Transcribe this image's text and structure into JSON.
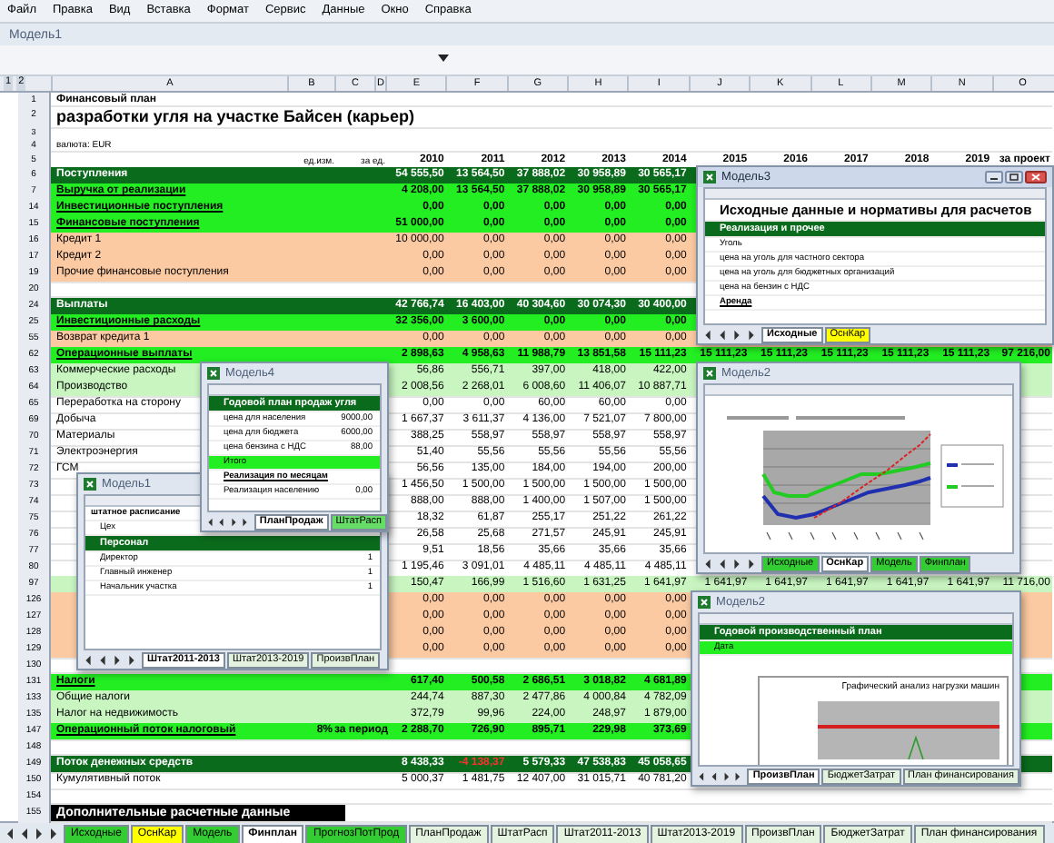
{
  "menu": [
    "Файл",
    "Правка",
    "Вид",
    "Вставка",
    "Формат",
    "Сервис",
    "Данные",
    "Окно",
    "Справка"
  ],
  "workbook_title": "Модель1",
  "outline_levels": [
    "1",
    "2"
  ],
  "columns": [
    "A",
    "B",
    "C",
    "D",
    "E",
    "F",
    "G",
    "H",
    "I",
    "J",
    "K",
    "L",
    "M",
    "N",
    "O"
  ],
  "header": {
    "row_numbers": [
      "1",
      "2",
      "3",
      "4",
      "5"
    ],
    "title": "Финансовый план",
    "subtitle": "разработки угля на участке Байсен (карьер)",
    "currency": "валюта: EUR",
    "unit": "ед.изм.",
    "per": "за ед.",
    "years": [
      "2010",
      "2011",
      "2012",
      "2013",
      "2014",
      "2015",
      "2016",
      "2017",
      "2018",
      "2019",
      "за проект"
    ]
  },
  "rows": [
    {
      "num": "6",
      "kind": "dark",
      "label": "Поступления",
      "values": [
        "54 555,50",
        "13 564,50",
        "37 888,02",
        "30 958,89",
        "30 565,17"
      ]
    },
    {
      "num": "7",
      "kind": "bright",
      "label": "Выручка от реализации",
      "values": [
        "4 208,00",
        "13 564,50",
        "37 888,02",
        "30 958,89",
        "30 565,17"
      ]
    },
    {
      "num": "14",
      "kind": "bright",
      "label": "Инвестиционные поступления",
      "values": [
        "0,00",
        "0,00",
        "0,00",
        "0,00",
        "0,00"
      ]
    },
    {
      "num": "15",
      "kind": "bright",
      "label": "Финансовые поступления",
      "values": [
        "51 000,00",
        "0,00",
        "0,00",
        "0,00",
        "0,00"
      ]
    },
    {
      "num": "16",
      "kind": "peach",
      "label": "Кредит 1",
      "values": [
        "10 000,00",
        "0,00",
        "0,00",
        "0,00",
        "0,00"
      ]
    },
    {
      "num": "17",
      "kind": "peach",
      "label": "Кредит 2",
      "values": [
        "0,00",
        "0,00",
        "0,00",
        "0,00",
        "0,00"
      ]
    },
    {
      "num": "19",
      "kind": "peach",
      "label": "Прочие финансовые поступления",
      "values": [
        "0,00",
        "0,00",
        "0,00",
        "0,00",
        "0,00"
      ]
    },
    {
      "num": "20",
      "kind": "blank"
    },
    {
      "num": "24",
      "kind": "dark",
      "label": "Выплаты",
      "values": [
        "42 766,74",
        "16 403,00",
        "40 304,60",
        "30 074,30",
        "30 400,00"
      ]
    },
    {
      "num": "25",
      "kind": "bright",
      "label": "Инвестиционные расходы",
      "values": [
        "32 356,00",
        "3 600,00",
        "0,00",
        "0,00",
        "0,00"
      ]
    },
    {
      "num": "55",
      "kind": "peach",
      "label": "Возврат кредита 1",
      "values": [
        "0,00",
        "0,00",
        "0,00",
        "0,00",
        "0,00"
      ]
    },
    {
      "num": "62",
      "kind": "bright",
      "label": "Операционные выплаты",
      "values": [
        "2 898,63",
        "4 958,63",
        "11 988,79",
        "13 851,58",
        "15 111,23",
        "15 111,23",
        "15 111,23",
        "15 111,23",
        "15 111,23",
        "15 111,23",
        "97 216,00"
      ]
    },
    {
      "num": "63",
      "kind": "light",
      "label": "Коммерческие расходы",
      "values": [
        "56,86",
        "556,71",
        "397,00",
        "418,00",
        "422,00"
      ]
    },
    {
      "num": "64",
      "kind": "light",
      "label": "Производство",
      "values": [
        "2 008,56",
        "2 268,01",
        "6 008,60",
        "11 406,07",
        "10 887,71"
      ]
    },
    {
      "num": "65",
      "kind": "plain",
      "label": "Переработка на сторону",
      "values": [
        "0,00",
        "0,00",
        "60,00",
        "60,00",
        "0,00"
      ]
    },
    {
      "num": "69",
      "kind": "plain",
      "label": "Добыча",
      "values": [
        "1 667,37",
        "3 611,37",
        "4 136,00",
        "7 521,07",
        "7 800,00"
      ]
    },
    {
      "num": "70",
      "kind": "plain",
      "label": "Материалы",
      "values": [
        "388,25",
        "558,97",
        "558,97",
        "558,97",
        "558,97"
      ]
    },
    {
      "num": "71",
      "kind": "plain",
      "label": "Электроэнергия",
      "values": [
        "51,40",
        "55,56",
        "55,56",
        "55,56",
        "55,56"
      ]
    },
    {
      "num": "72",
      "kind": "plain",
      "label": "ГСМ",
      "values": [
        "56,56",
        "135,00",
        "184,00",
        "194,00",
        "200,00"
      ]
    },
    {
      "num": "73",
      "kind": "plain",
      "values": [
        "1 456,50",
        "1 500,00",
        "1 500,00",
        "1 500,00",
        "1 500,00"
      ]
    },
    {
      "num": "74",
      "kind": "plain",
      "values": [
        "888,00",
        "888,00",
        "1 400,00",
        "1 507,00",
        "1 500,00"
      ]
    },
    {
      "num": "75",
      "kind": "plain",
      "values": [
        "18,32",
        "61,87",
        "255,17",
        "251,22",
        "261,22"
      ]
    },
    {
      "num": "76",
      "kind": "plain",
      "values": [
        "26,58",
        "25,68",
        "271,57",
        "245,91",
        "245,91"
      ]
    },
    {
      "num": "77",
      "kind": "plain",
      "values": [
        "9,51",
        "18,56",
        "35,66",
        "35,66",
        "35,66"
      ]
    },
    {
      "num": "80",
      "kind": "plain",
      "values": [
        "1 195,46",
        "3 091,01",
        "4 485,11",
        "4 485,11",
        "4 485,11"
      ]
    },
    {
      "num": "97",
      "kind": "light",
      "values": [
        "150,47",
        "166,99",
        "1 516,60",
        "1 631,25",
        "1 641,97",
        "1 641,97",
        "1 641,97",
        "1 641,97",
        "1 641,97",
        "1 641,97",
        "11 716,00"
      ]
    },
    {
      "num": "126",
      "kind": "peach",
      "values": [
        "0,00",
        "0,00",
        "0,00",
        "0,00",
        "0,00"
      ]
    },
    {
      "num": "127",
      "kind": "peach",
      "values": [
        "0,00",
        "0,00",
        "0,00",
        "0,00",
        "0,00"
      ]
    },
    {
      "num": "128",
      "kind": "peach",
      "values": [
        "0,00",
        "0,00",
        "0,00",
        "0,00",
        "0,00"
      ]
    },
    {
      "num": "129",
      "kind": "peach",
      "values": [
        "0,00",
        "0,00",
        "0,00",
        "0,00",
        "0,00"
      ]
    },
    {
      "num": "130",
      "kind": "plain"
    },
    {
      "num": "131",
      "kind": "bright",
      "label": "Налоги",
      "values": [
        "617,40",
        "500,58",
        "2 686,51",
        "3 018,82",
        "4 681,89"
      ]
    },
    {
      "num": "133",
      "kind": "light",
      "label": "Общие налоги",
      "values": [
        "244,74",
        "887,30",
        "2 477,86",
        "4 000,84",
        "4 782,09"
      ]
    },
    {
      "num": "135",
      "kind": "light",
      "label": "Налог на недвижимость",
      "values": [
        "372,79",
        "99,96",
        "224,00",
        "248,97",
        "1 879,00"
      ]
    },
    {
      "num": "147",
      "kind": "bright",
      "label": "Операционный поток налоговый",
      "b": "8%",
      "c": "за период",
      "values": [
        "2 288,70",
        "726,90",
        "895,71",
        "229,98",
        "373,69"
      ]
    },
    {
      "num": "148",
      "kind": "blank"
    },
    {
      "num": "149",
      "kind": "dark",
      "label": "Поток денежных средств",
      "values": [
        "8 438,33",
        {
          "text": "-4 138,37",
          "negative": true
        },
        "5 579,33",
        "47 538,83",
        "45 058,65"
      ]
    },
    {
      "num": "150",
      "kind": "plain",
      "label": "Кумулятивный поток",
      "values": [
        "5 000,37",
        "1 481,75",
        "12 407,00",
        "31 015,71",
        "40 781,20"
      ]
    },
    {
      "num": "154",
      "kind": "blank"
    },
    {
      "num": "155",
      "kind": "black",
      "label": "Дополнительные расчетные данные"
    }
  ],
  "windows": [
    {
      "kind": "staff",
      "title": "Модель1",
      "active": false,
      "rows": [
        {
          "kind": "subheading",
          "text": "штатное расписание"
        },
        {
          "kind": "plain",
          "text": "Цех"
        },
        {
          "kind": "band",
          "text": "Персонал"
        },
        {
          "kind": "plain",
          "text": "Директор",
          "value": "1"
        },
        {
          "kind": "plain",
          "text": "Главный инженер",
          "value": "1"
        },
        {
          "kind": "plain",
          "text": "Начальник участка",
          "value": "1"
        }
      ],
      "tabs": [
        {
          "label": "Штат2011-2013",
          "selected": true
        },
        {
          "label": "Штат2013-2019",
          "selected": false
        },
        {
          "label": "ПроизвПлан",
          "selected": false
        }
      ]
    },
    {
      "kind": "sales",
      "title": "Модель4",
      "active": false,
      "rows": [
        {
          "kind": "band",
          "text": "Годовой план продаж угля"
        },
        {
          "kind": "plain",
          "text": "цена для населения",
          "value": "9000,00"
        },
        {
          "kind": "plain",
          "text": "цена для бюджета",
          "value": "6000,00"
        },
        {
          "kind": "plain",
          "text": "цена бензина с НДС",
          "value": "88,00"
        },
        {
          "kind": "bright",
          "text": "Итого"
        },
        {
          "kind": "link",
          "text": "Реализация по месяцам"
        },
        {
          "kind": "plain",
          "text": "Реализация населению",
          "value": "0,00"
        }
      ],
      "tabs": [
        {
          "label": "ПланПродаж",
          "selected": true
        },
        {
          "label": "ШтатРасп",
          "selected": false,
          "color": "#66dd66"
        }
      ]
    },
    {
      "kind": "notes",
      "title": "Модель3",
      "active": true,
      "rows": [
        {
          "kind": "heading",
          "text": "Исходные данные и нормативы для расчетов"
        },
        {
          "kind": "band",
          "text": "Реализация и прочее"
        },
        {
          "kind": "plain",
          "text": "Уголь"
        },
        {
          "kind": "plain",
          "text": "цена на уголь для частного сектора"
        },
        {
          "kind": "plain",
          "text": "цена на уголь для бюджетных организаций"
        },
        {
          "kind": "plain",
          "text": "цена на бензин с НДС"
        },
        {
          "kind": "link",
          "text": "Аренда"
        }
      ],
      "tabs": [
        {
          "label": "Исходные",
          "selected": true
        },
        {
          "label": "ОснКар",
          "selected": false,
          "color": "#ffff00"
        }
      ]
    },
    {
      "kind": "chart",
      "title": "Модель2",
      "active": false,
      "tabs": [
        {
          "label": "Исходные",
          "selected": false,
          "color": "#33cc33"
        },
        {
          "label": "ОснКар",
          "selected": true
        },
        {
          "label": "Модель",
          "selected": false,
          "color": "#33cc33"
        },
        {
          "label": "Финплан",
          "selected": false,
          "color": "#33cc33"
        }
      ]
    },
    {
      "kind": "production",
      "title": "Модель2",
      "active": false,
      "chart_title": "Графический анализ нагрузки машин",
      "rows": [
        {
          "kind": "band",
          "text": "Годовой производственный план"
        },
        {
          "kind": "bright",
          "text": "Дата"
        }
      ],
      "tabs": [
        {
          "label": "ПроизвПлан",
          "selected": true
        },
        {
          "label": "БюджетЗатрат",
          "selected": false
        },
        {
          "label": "План финансирования",
          "selected": false
        }
      ]
    }
  ],
  "sheet_tabs": [
    {
      "label": "Исходные",
      "selected": false,
      "color": "#33cc33"
    },
    {
      "label": "ОснКар",
      "selected": false,
      "color": "#ffff00"
    },
    {
      "label": "Модель",
      "selected": false,
      "color": "#33cc33"
    },
    {
      "label": "Финплан",
      "selected": true
    },
    {
      "label": "ПрогнозПотПрод",
      "selected": false,
      "color": "#33cc33"
    },
    {
      "label": "ПланПродаж",
      "selected": false
    },
    {
      "label": "ШтатРасп",
      "selected": false
    },
    {
      "label": "Штат2011-2013",
      "selected": false
    },
    {
      "label": "Штат2013-2019",
      "selected": false
    },
    {
      "label": "ПроизвПлан",
      "selected": false
    },
    {
      "label": "БюджетЗатрат",
      "selected": false
    },
    {
      "label": "План финансирования",
      "selected": false
    }
  ]
}
